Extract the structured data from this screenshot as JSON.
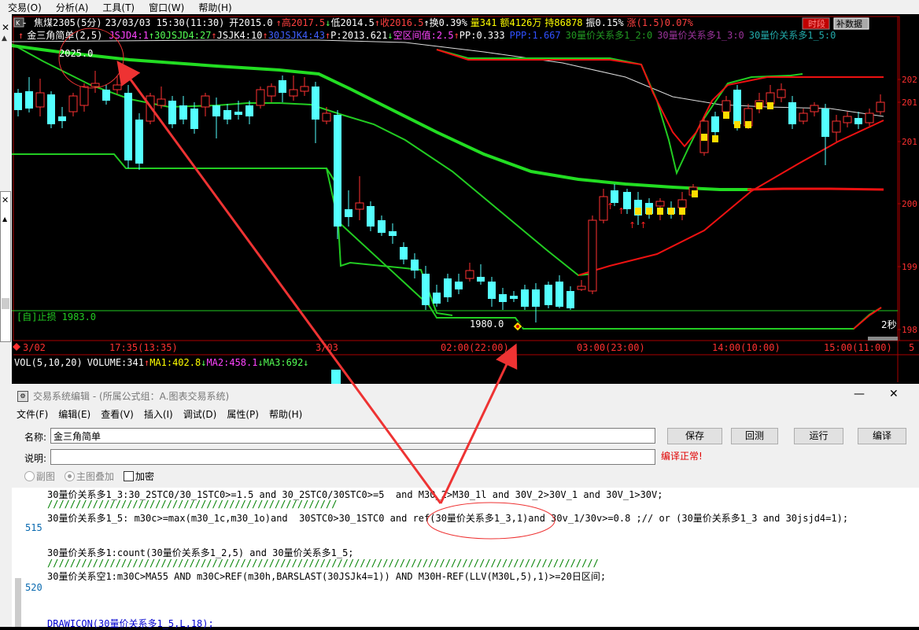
{
  "menubar": [
    "交易(O)",
    "分析(A)",
    "工具(T)",
    "窗口(W)",
    "帮助(H)"
  ],
  "chart": {
    "header": {
      "symbol": "焦煤2305(5分)",
      "datetime": "23/03/03 15:30(11:30)",
      "open": "开2015.0",
      "high": "高2017.5",
      "low": "低2014.5",
      "close": "收2016.5",
      "turnover": "换0.39%",
      "volume": "量341",
      "amount": "额4126万",
      "hold": "持86878",
      "amp": "振0.15%",
      "change": "涨(1.5)0.07%",
      "btn_time": "时段",
      "btn_supplement": "补数据"
    },
    "indicator_line": {
      "name": "金三角简单(2,5)",
      "jsjd4": "JSJD4:1",
      "jsjd30": "30JSJD4:27",
      "jsjk4": "JSJK4:10",
      "jsjk30": "30JSJK4:43",
      "p": "P:2013.621",
      "kongqu": "空区间值:2.5",
      "pp": "PP:0.333",
      "ppp": "PPP:1.667",
      "c1": "30量价关系多1_2:0",
      "c2": "30量价关系多1_3:0",
      "c3": "30量价关系多1_5:0"
    },
    "labels": {
      "price_top": "2025.0",
      "price_low": "1980.0",
      "stoploss": "[自]止损 1983.0",
      "seconds": "2秒"
    },
    "y_ticks": [
      "202",
      "201",
      "201",
      "200",
      "199",
      "198"
    ],
    "x_ticks": [
      "3/02",
      "17:35(13:35)",
      "3/03",
      "02:00(22:00)",
      "03:00(23:00)",
      "14:00(10:00)",
      "15:00(11:00)",
      "5"
    ],
    "vol": {
      "label": "VOL(5,10,20)",
      "volume": "VOLUME:341",
      "ma1": "MA1:402.8",
      "ma2": "MA2:458.1",
      "ma3": "MA3:692"
    },
    "colors": {
      "up": "#ff3232",
      "down": "#54ffff",
      "green": "#22cc22",
      "red": "#ee1111",
      "white": "#dddddd"
    }
  },
  "editor": {
    "title": "交易系统编辑 - (所属公式组：A.图表交易系统)",
    "menu": [
      "文件(F)",
      "编辑(E)",
      "查看(V)",
      "插入(I)",
      "调试(D)",
      "属性(P)",
      "帮助(H)"
    ],
    "name_label": "名称:",
    "name_value": "金三角简单",
    "desc_label": "说明:",
    "desc_value": "",
    "buttons": {
      "save": "保存",
      "revert": "回测",
      "run": "运行",
      "compile": "编译"
    },
    "status": "编译正常!",
    "radio_sub": "副图",
    "radio_main": "主图叠加",
    "checkbox_encrypt": "加密",
    "line_numbers": [
      "515",
      "520"
    ],
    "code_lines": [
      "30量价关系多1_3:30_2STC0/30_1STC0>=1.5 and 30_2STC0/30STC0>=5  and M30_2>M30_1l and 30V_2>30V_1 and 30V_1>30V;",
      "///////////////////////////////////////////////////",
      "30量价关系多1_5: m30c>=max(m30_1c,m30_1o)and  30STC0>30_1STC0 and ref(30量价关系多1_3,1)and 30v_1/30v>=0.8 ;// or (30量价关系多1_3 and 30jsjd4=1);",
      "30量价关系多1:count(30量价关系多1_2,5) and 30量价关系多1_5;",
      "/////////////////////////////////////////////////////////////////////////////////////////////////",
      "30量价关系空1:m30C>MA55 AND m30C>REF(m30h,BARSLAST(30JSJk4=1)) AND M30H-REF(LLV(M30L,5),1)>=20日区间;",
      "DRAWICON(30量价关系多1_5,L,18);"
    ]
  }
}
